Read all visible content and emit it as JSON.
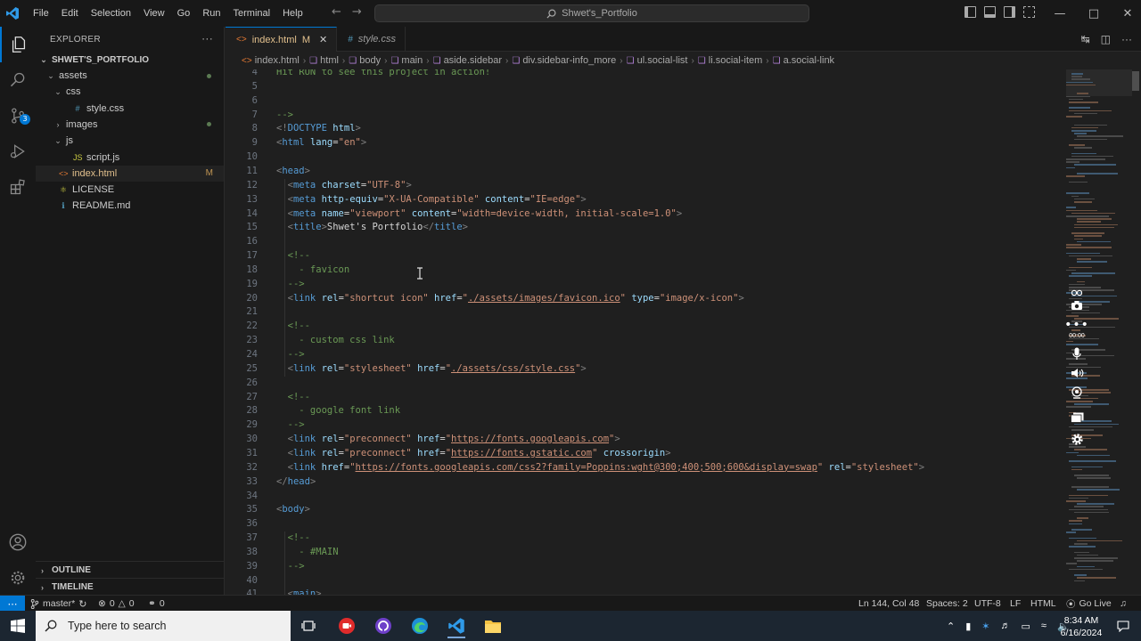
{
  "window": {
    "title": "Shwet's_Portfolio",
    "menu": [
      "File",
      "Edit",
      "Selection",
      "View",
      "Go",
      "Run",
      "Terminal",
      "Help"
    ]
  },
  "activity_bar": {
    "scm_badge": "3"
  },
  "explorer": {
    "header": "EXPLORER",
    "root": "SHWET'S_PORTFOLIO",
    "items": [
      {
        "label": "assets",
        "kind": "folder",
        "open": true,
        "depth": 1,
        "status": "dot"
      },
      {
        "label": "css",
        "kind": "folder",
        "open": true,
        "depth": 2,
        "status": ""
      },
      {
        "label": "style.css",
        "kind": "css",
        "depth": 3,
        "status": ""
      },
      {
        "label": "images",
        "kind": "folder",
        "open": false,
        "depth": 2,
        "status": "dot"
      },
      {
        "label": "js",
        "kind": "folder",
        "open": true,
        "depth": 2,
        "status": ""
      },
      {
        "label": "script.js",
        "kind": "js",
        "depth": 3,
        "status": ""
      },
      {
        "label": "index.html",
        "kind": "html",
        "depth": 1,
        "status": "M"
      },
      {
        "label": "LICENSE",
        "kind": "license",
        "depth": 1,
        "status": ""
      },
      {
        "label": "README.md",
        "kind": "md",
        "depth": 1,
        "status": ""
      }
    ],
    "outline": "OUTLINE",
    "timeline": "TIMELINE"
  },
  "tabs": [
    {
      "label": "index.html",
      "modified": "M",
      "active": true
    },
    {
      "label": "style.css",
      "modified": "",
      "active": false
    }
  ],
  "breadcrumb": [
    "index.html",
    "html",
    "body",
    "main",
    "aside.sidebar",
    "div.sidebar-info_more",
    "ul.social-list",
    "li.social-item",
    "a.social-link"
  ],
  "code_lines": [
    {
      "n": "4",
      "tokens": [
        {
          "t": "Hit RUN to see this project in action!",
          "c": "com"
        }
      ]
    },
    {
      "n": "5",
      "tokens": []
    },
    {
      "n": "6",
      "tokens": []
    },
    {
      "n": "7",
      "tokens": [
        {
          "t": "-->",
          "c": "com"
        }
      ]
    },
    {
      "n": "8",
      "tokens": [
        {
          "t": "<!",
          "c": "tag"
        },
        {
          "t": "DOCTYPE",
          "c": "name"
        },
        {
          "t": " html",
          "c": "attr"
        },
        {
          "t": ">",
          "c": "tag"
        }
      ]
    },
    {
      "n": "9",
      "tokens": [
        {
          "t": "<",
          "c": "tag"
        },
        {
          "t": "html",
          "c": "name"
        },
        {
          "t": " lang",
          "c": "attr"
        },
        {
          "t": "=",
          "c": "txt"
        },
        {
          "t": "\"en\"",
          "c": "val"
        },
        {
          "t": ">",
          "c": "tag"
        }
      ]
    },
    {
      "n": "10",
      "tokens": []
    },
    {
      "n": "11",
      "tokens": [
        {
          "t": "<",
          "c": "tag"
        },
        {
          "t": "head",
          "c": "name"
        },
        {
          "t": ">",
          "c": "tag"
        }
      ]
    },
    {
      "n": "12",
      "tokens": [
        {
          "t": "  <",
          "c": "tag"
        },
        {
          "t": "meta",
          "c": "name"
        },
        {
          "t": " charset",
          "c": "attr"
        },
        {
          "t": "=",
          "c": "txt"
        },
        {
          "t": "\"UTF-8\"",
          "c": "val"
        },
        {
          "t": ">",
          "c": "tag"
        }
      ]
    },
    {
      "n": "13",
      "tokens": [
        {
          "t": "  <",
          "c": "tag"
        },
        {
          "t": "meta",
          "c": "name"
        },
        {
          "t": " http-equiv",
          "c": "attr"
        },
        {
          "t": "=",
          "c": "txt"
        },
        {
          "t": "\"X-UA-Compatible\"",
          "c": "val"
        },
        {
          "t": " content",
          "c": "attr"
        },
        {
          "t": "=",
          "c": "txt"
        },
        {
          "t": "\"IE=edge\"",
          "c": "val"
        },
        {
          "t": ">",
          "c": "tag"
        }
      ]
    },
    {
      "n": "14",
      "tokens": [
        {
          "t": "  <",
          "c": "tag"
        },
        {
          "t": "meta",
          "c": "name"
        },
        {
          "t": " name",
          "c": "attr"
        },
        {
          "t": "=",
          "c": "txt"
        },
        {
          "t": "\"viewport\"",
          "c": "val"
        },
        {
          "t": " content",
          "c": "attr"
        },
        {
          "t": "=",
          "c": "txt"
        },
        {
          "t": "\"width=device-width, initial-scale=1.0\"",
          "c": "val"
        },
        {
          "t": ">",
          "c": "tag"
        }
      ]
    },
    {
      "n": "15",
      "tokens": [
        {
          "t": "  <",
          "c": "tag"
        },
        {
          "t": "title",
          "c": "name"
        },
        {
          "t": ">",
          "c": "tag"
        },
        {
          "t": "Shwet's Portfolio",
          "c": "txt"
        },
        {
          "t": "</",
          "c": "tag"
        },
        {
          "t": "title",
          "c": "name"
        },
        {
          "t": ">",
          "c": "tag"
        }
      ]
    },
    {
      "n": "16",
      "tokens": []
    },
    {
      "n": "17",
      "tokens": [
        {
          "t": "  <!--",
          "c": "com"
        }
      ]
    },
    {
      "n": "18",
      "tokens": [
        {
          "t": "    - favicon",
          "c": "com"
        }
      ]
    },
    {
      "n": "19",
      "tokens": [
        {
          "t": "  -->",
          "c": "com"
        }
      ]
    },
    {
      "n": "20",
      "tokens": [
        {
          "t": "  <",
          "c": "tag"
        },
        {
          "t": "link",
          "c": "name"
        },
        {
          "t": " rel",
          "c": "attr"
        },
        {
          "t": "=",
          "c": "txt"
        },
        {
          "t": "\"shortcut icon\"",
          "c": "val"
        },
        {
          "t": " href",
          "c": "attr"
        },
        {
          "t": "=",
          "c": "txt"
        },
        {
          "t": "\"",
          "c": "val"
        },
        {
          "t": "./assets/images/favicon.ico",
          "c": "valu"
        },
        {
          "t": "\"",
          "c": "val"
        },
        {
          "t": " type",
          "c": "attr"
        },
        {
          "t": "=",
          "c": "txt"
        },
        {
          "t": "\"image/x-icon\"",
          "c": "val"
        },
        {
          "t": ">",
          "c": "tag"
        }
      ]
    },
    {
      "n": "21",
      "tokens": []
    },
    {
      "n": "22",
      "tokens": [
        {
          "t": "  <!--",
          "c": "com"
        }
      ]
    },
    {
      "n": "23",
      "tokens": [
        {
          "t": "    - custom css link",
          "c": "com"
        }
      ]
    },
    {
      "n": "24",
      "tokens": [
        {
          "t": "  -->",
          "c": "com"
        }
      ]
    },
    {
      "n": "25",
      "tokens": [
        {
          "t": "  <",
          "c": "tag"
        },
        {
          "t": "link",
          "c": "name"
        },
        {
          "t": " rel",
          "c": "attr"
        },
        {
          "t": "=",
          "c": "txt"
        },
        {
          "t": "\"stylesheet\"",
          "c": "val"
        },
        {
          "t": " href",
          "c": "attr"
        },
        {
          "t": "=",
          "c": "txt"
        },
        {
          "t": "\"",
          "c": "val"
        },
        {
          "t": "./assets/css/style.css",
          "c": "valu"
        },
        {
          "t": "\"",
          "c": "val"
        },
        {
          "t": ">",
          "c": "tag"
        }
      ]
    },
    {
      "n": "26",
      "tokens": []
    },
    {
      "n": "27",
      "tokens": [
        {
          "t": "  <!--",
          "c": "com"
        }
      ]
    },
    {
      "n": "28",
      "tokens": [
        {
          "t": "    - google font link",
          "c": "com"
        }
      ]
    },
    {
      "n": "29",
      "tokens": [
        {
          "t": "  -->",
          "c": "com"
        }
      ]
    },
    {
      "n": "30",
      "tokens": [
        {
          "t": "  <",
          "c": "tag"
        },
        {
          "t": "link",
          "c": "name"
        },
        {
          "t": " rel",
          "c": "attr"
        },
        {
          "t": "=",
          "c": "txt"
        },
        {
          "t": "\"preconnect\"",
          "c": "val"
        },
        {
          "t": " href",
          "c": "attr"
        },
        {
          "t": "=",
          "c": "txt"
        },
        {
          "t": "\"",
          "c": "val"
        },
        {
          "t": "https://fonts.googleapis.com",
          "c": "valu"
        },
        {
          "t": "\"",
          "c": "val"
        },
        {
          "t": ">",
          "c": "tag"
        }
      ]
    },
    {
      "n": "31",
      "tokens": [
        {
          "t": "  <",
          "c": "tag"
        },
        {
          "t": "link",
          "c": "name"
        },
        {
          "t": " rel",
          "c": "attr"
        },
        {
          "t": "=",
          "c": "txt"
        },
        {
          "t": "\"preconnect\"",
          "c": "val"
        },
        {
          "t": " href",
          "c": "attr"
        },
        {
          "t": "=",
          "c": "txt"
        },
        {
          "t": "\"",
          "c": "val"
        },
        {
          "t": "https://fonts.gstatic.com",
          "c": "valu"
        },
        {
          "t": "\"",
          "c": "val"
        },
        {
          "t": " crossorigin",
          "c": "attr"
        },
        {
          "t": ">",
          "c": "tag"
        }
      ]
    },
    {
      "n": "32",
      "tokens": [
        {
          "t": "  <",
          "c": "tag"
        },
        {
          "t": "link",
          "c": "name"
        },
        {
          "t": " href",
          "c": "attr"
        },
        {
          "t": "=",
          "c": "txt"
        },
        {
          "t": "\"",
          "c": "val"
        },
        {
          "t": "https://fonts.googleapis.com/css2?family=Poppins:wght@300;400;500;600&display=swap",
          "c": "valu"
        },
        {
          "t": "\"",
          "c": "val"
        },
        {
          "t": " rel",
          "c": "attr"
        },
        {
          "t": "=",
          "c": "txt"
        },
        {
          "t": "\"stylesheet\"",
          "c": "val"
        },
        {
          "t": ">",
          "c": "tag"
        }
      ]
    },
    {
      "n": "33",
      "tokens": [
        {
          "t": "</",
          "c": "tag"
        },
        {
          "t": "head",
          "c": "name"
        },
        {
          "t": ">",
          "c": "tag"
        }
      ]
    },
    {
      "n": "34",
      "tokens": []
    },
    {
      "n": "35",
      "tokens": [
        {
          "t": "<",
          "c": "tag"
        },
        {
          "t": "body",
          "c": "name"
        },
        {
          "t": ">",
          "c": "tag"
        }
      ]
    },
    {
      "n": "36",
      "tokens": []
    },
    {
      "n": "37",
      "tokens": [
        {
          "t": "  <!--",
          "c": "com"
        }
      ]
    },
    {
      "n": "38",
      "tokens": [
        {
          "t": "    - #MAIN",
          "c": "com"
        }
      ]
    },
    {
      "n": "39",
      "tokens": [
        {
          "t": "  -->",
          "c": "com"
        }
      ]
    },
    {
      "n": "40",
      "tokens": []
    },
    {
      "n": "41",
      "tokens": [
        {
          "t": "  <",
          "c": "tag"
        },
        {
          "t": "main",
          "c": "name"
        },
        {
          "t": ">",
          "c": "tag"
        }
      ]
    }
  ],
  "recording_overlay": {
    "time": "00:00"
  },
  "status_bar": {
    "branch": "master*",
    "errors": "0",
    "warnings": "0",
    "ports": "0",
    "position": "Ln 144, Col 48",
    "spaces": "Spaces: 2",
    "encoding": "UTF-8",
    "eol": "LF",
    "language": "HTML",
    "golive": "Go Live"
  },
  "taskbar": {
    "search_placeholder": "Type here to search",
    "time": "8:34 AM",
    "date": "6/16/2024"
  },
  "colors": {
    "accent": "#0078d4",
    "modified": "#e2c08d",
    "comment": "#6a9955",
    "tag_name": "#569cd6",
    "attribute": "#9cdcfe",
    "string": "#ce9178"
  }
}
